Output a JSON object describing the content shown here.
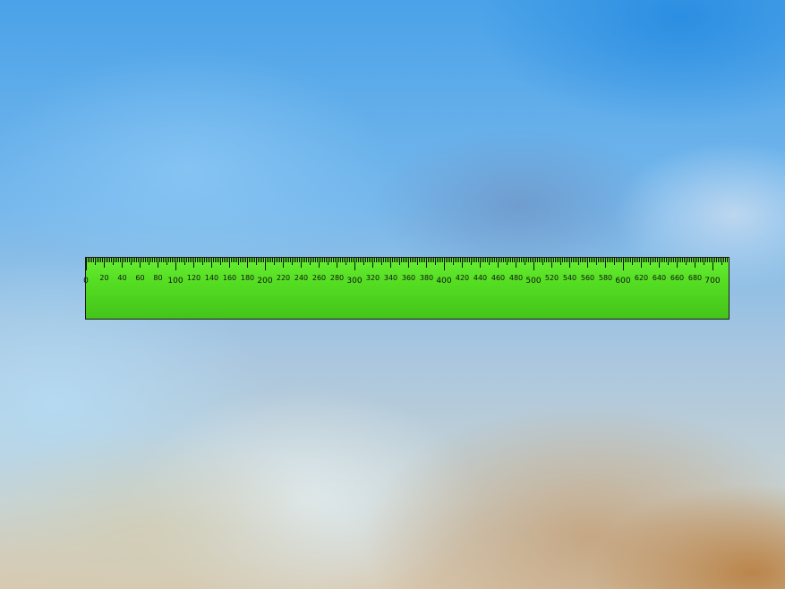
{
  "ruler": {
    "orientation": "horizontal",
    "units": "px",
    "length": 720,
    "minor_step": 2,
    "mid_step": 10,
    "label_step": 20,
    "major_step": 100,
    "labels": [
      "0",
      "20",
      "40",
      "60",
      "80",
      "100",
      "120",
      "140",
      "160",
      "180",
      "200",
      "220",
      "240",
      "260",
      "280",
      "300",
      "320",
      "340",
      "360",
      "380",
      "400",
      "420",
      "440",
      "460",
      "480",
      "500",
      "520",
      "540",
      "560",
      "580",
      "600",
      "620",
      "640",
      "660",
      "680",
      "700"
    ],
    "colors": {
      "fill_top": "#66ee33",
      "fill_bottom": "#44c41a",
      "ticks": "#111111",
      "border": "#1a1a1a"
    }
  }
}
